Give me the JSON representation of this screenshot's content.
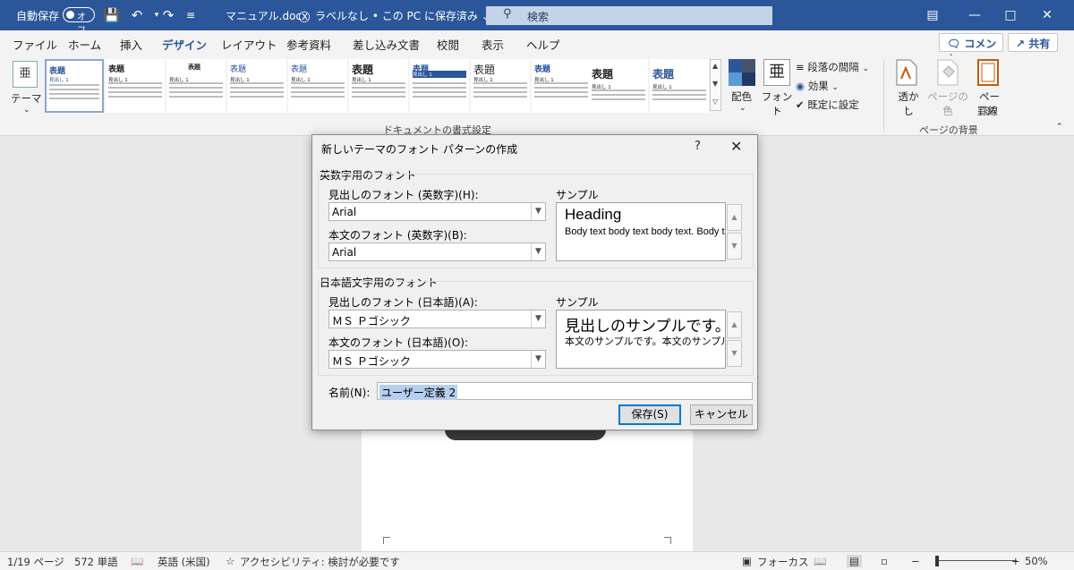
{
  "titlebar": {
    "autosave_label": "自動保存",
    "autosave_state": "オフ",
    "doc_name": "マニュアル.docx",
    "label_info": "ラベルなし • この PC に保存済み ⌄",
    "search_placeholder": "検索"
  },
  "tabs": [
    "ファイル",
    "ホーム",
    "挿入",
    "デザイン",
    "レイアウト",
    "参考資料",
    "差し込み文書",
    "校閲",
    "表示",
    "ヘルプ"
  ],
  "active_tab": "デザイン",
  "header_buttons": {
    "comment": "コメント",
    "share": "共有"
  },
  "ribbon": {
    "theme_label": "テーマ",
    "style_gallery": [
      {
        "title": "表題",
        "sub": "見出し 1"
      },
      {
        "title": "表題",
        "sub": "見出し 1"
      },
      {
        "title": "表題",
        "sub": "見出し 1"
      },
      {
        "title": "表題",
        "sub": "見出し 1"
      },
      {
        "title": "表題",
        "sub": "見出し 1"
      },
      {
        "title": "表題",
        "sub": "見出し 1"
      },
      {
        "title": "表題",
        "sub": "見出し 1"
      },
      {
        "title": "表題",
        "sub": "見出し 1"
      },
      {
        "title": "表題",
        "sub": "見出し 1"
      },
      {
        "title": "表題",
        "sub": "見出し 1"
      },
      {
        "title": "表題",
        "sub": "見出し 1"
      }
    ],
    "doc_format_group": "ドキュメントの書式設定",
    "colors_label": "配色",
    "fonts_label": "フォント",
    "paragraph_spacing": "段落の間隔",
    "effects": "効果",
    "set_default": "既定に設定",
    "watermark": "透かし",
    "page_color": "ページの色",
    "page_borders_1": "ページ",
    "page_borders_2": "罫線",
    "page_bg_group": "ページの背景"
  },
  "dialog": {
    "title": "新しいテーマのフォント パターンの作成",
    "help": "?",
    "latin_group": "英数字用のフォント",
    "latin_heading_label": "見出しのフォント (英数字)(H):",
    "latin_heading_value": "Arial",
    "latin_body_label": "本文のフォント (英数字)(B):",
    "latin_body_value": "Arial",
    "sample_label_1": "サンプル",
    "sample_heading_1": "Heading",
    "sample_body_1": "Body text body text body text. Body text",
    "ea_group": "日本語文字用のフォント",
    "ea_heading_label": "見出しのフォント (日本語)(A):",
    "ea_heading_value": "ＭＳ Ｐゴシック",
    "ea_body_label": "本文のフォント (日本語)(O):",
    "ea_body_value": "ＭＳ Ｐゴシック",
    "sample_label_2": "サンプル",
    "sample_heading_2": "見出しのサンプルです。",
    "sample_body_2": "本文のサンプルです。本文のサンプルです。",
    "name_label": "名前(N):",
    "name_value": "ユーザー定義 2",
    "save": "保存(S)",
    "cancel": "キャンセル"
  },
  "status": {
    "page": "1/19 ページ",
    "words": "572 単語",
    "language": "英語 (米国)",
    "accessibility": "アクセシビリティ: 検討が必要です",
    "focus": "フォーカス",
    "zoom_minus": "−",
    "zoom_plus": "+",
    "zoom": "50%"
  },
  "colors": {
    "titlebar": "#2b579a",
    "accent": "#0078d7"
  }
}
